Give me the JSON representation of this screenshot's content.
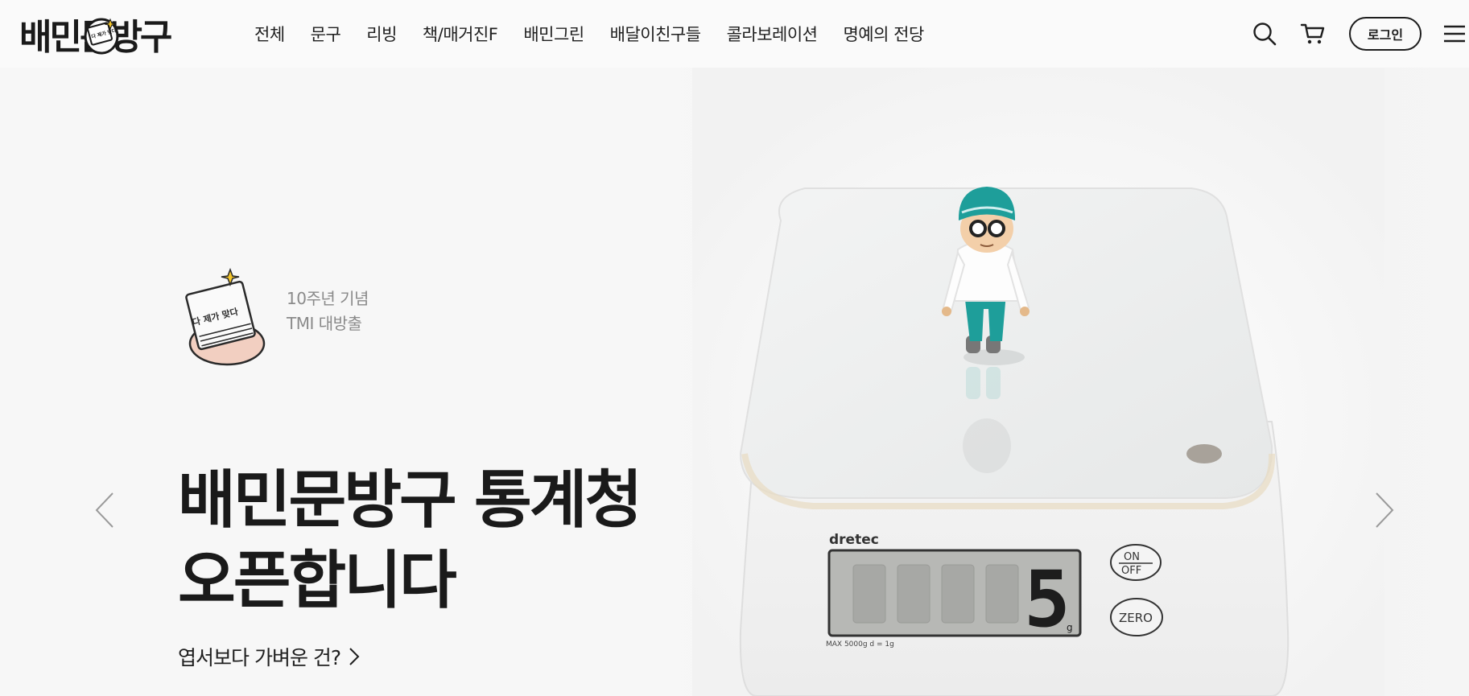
{
  "header": {
    "logo": "배민문방구",
    "logo_badge_text": "다 제가 맞다",
    "nav": [
      "전체",
      "문구",
      "리빙",
      "책/매거진F",
      "배민그린",
      "배달이친구들",
      "콜라보레이션",
      "명예의 전당"
    ],
    "login_label": "로그인",
    "icons": [
      "search-icon",
      "cart-icon",
      "hamburger-menu-icon"
    ]
  },
  "hero": {
    "badge_line1": "10주년 기념",
    "badge_line2": "TMI 대방출",
    "badge_icon_text": "다 제가 맞다",
    "title_line1": "배민문방구 통계청",
    "title_line2": "오픈합니다",
    "link_text": "엽서보다 가벼운 건?",
    "scale_brand": "dretec",
    "scale_button_on": "ON",
    "scale_button_off": "OFF",
    "scale_button_zero": "ZERO",
    "scale_spec": "MAX 5000g  d = 1g",
    "scale_display_value": "5",
    "scale_unit": "g"
  },
  "colors": {
    "background": "#f8f8f8",
    "text": "#1e1e1e",
    "muted_text": "#8a8a8a",
    "figure_teal": "#1e9e9a"
  }
}
